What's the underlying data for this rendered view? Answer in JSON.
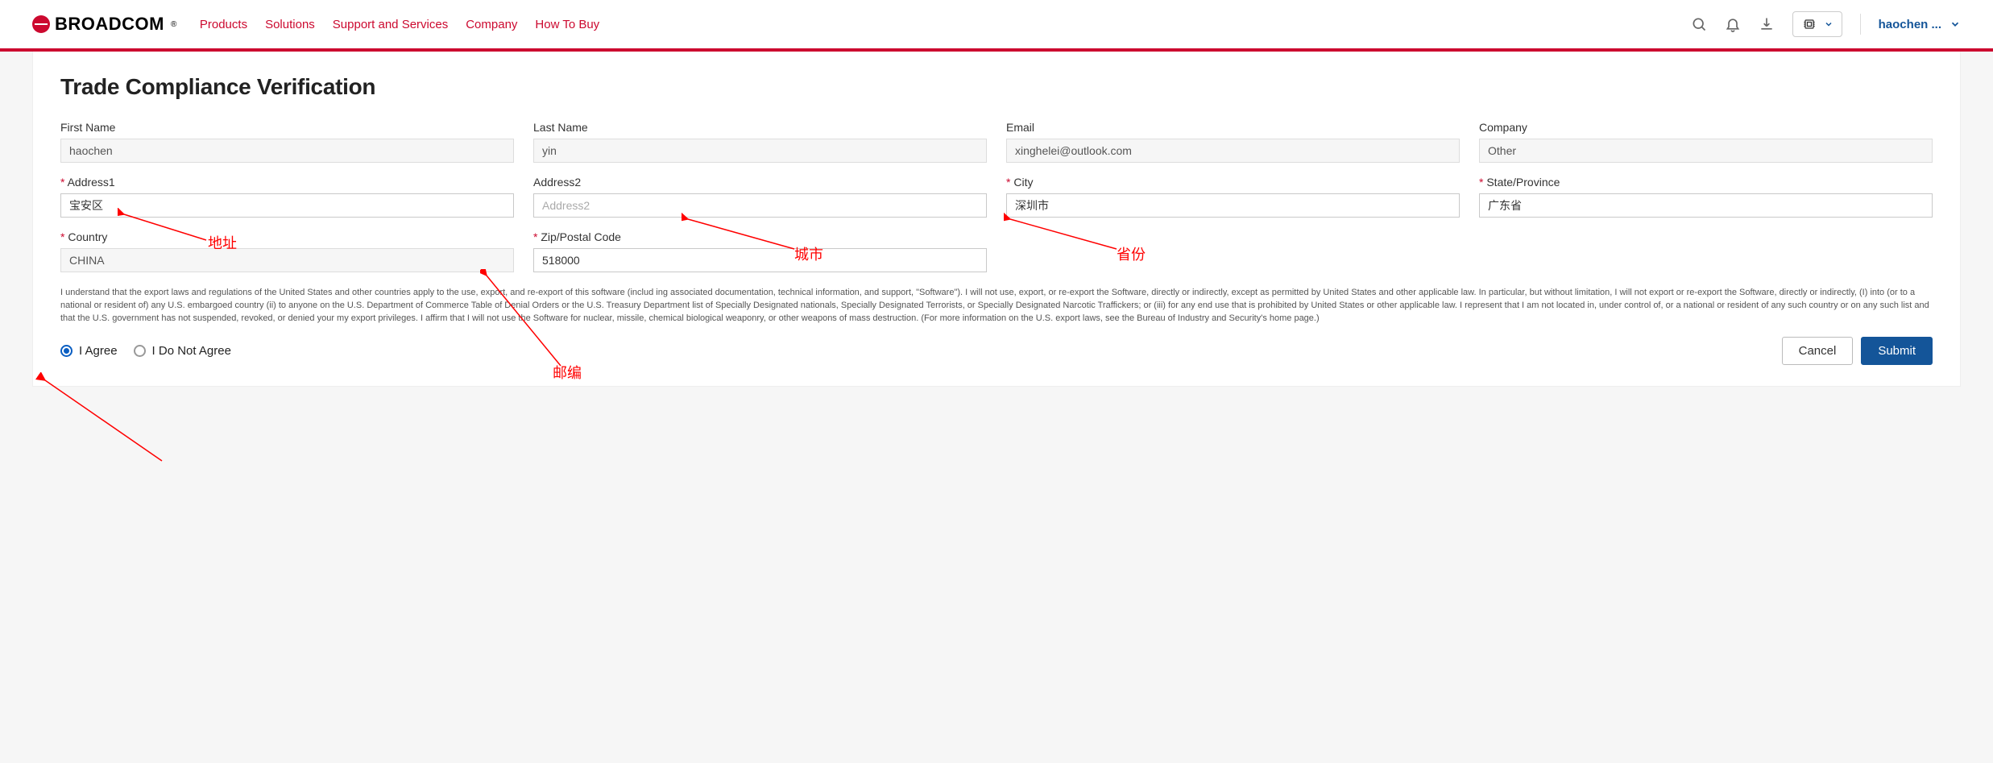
{
  "brand": {
    "name": "BROADCOM"
  },
  "nav": {
    "products": "Products",
    "solutions": "Solutions",
    "support": "Support and Services",
    "company": "Company",
    "howtobuy": "How To Buy"
  },
  "user": {
    "display": "haochen ..."
  },
  "page": {
    "title": "Trade Compliance Verification"
  },
  "fields": {
    "first_name": {
      "label": "First Name",
      "value": "haochen"
    },
    "last_name": {
      "label": "Last Name",
      "value": "yin"
    },
    "email": {
      "label": "Email",
      "value": "xinghelei@outlook.com"
    },
    "company": {
      "label": "Company",
      "value": "Other"
    },
    "address1": {
      "label": "Address1",
      "value": "宝安区"
    },
    "address2": {
      "label": "Address2",
      "placeholder": "Address2",
      "value": ""
    },
    "city": {
      "label": "City",
      "value": "深圳市"
    },
    "state": {
      "label": "State/Province",
      "value": "广东省"
    },
    "country": {
      "label": "Country",
      "value": "CHINA"
    },
    "zip": {
      "label": "Zip/Postal Code",
      "value": "518000"
    }
  },
  "disclaimer": "I understand that the export laws and regulations of the United States and other countries apply to the use, export, and re-export of this software (includ ing associated documentation, technical information, and support, \"Software\"). I will not use, export, or re-export the Software, directly or indirectly, except as permitted by United States and other applicable law. In particular, but without limitation, I will not export or re-export the Software, directly or indirectly, (I) into (or to a national or resident of) any U.S. embargoed country (ii) to anyone on the U.S. Department of Commerce Table of Denial Orders or the U.S. Treasury Department list of Specially Designated nationals, Specially Designated Terrorists, or Specially Designated Narcotic Traffickers; or (iii) for any end use that is prohibited by United States or other applicable law. I represent that I am not located in, under control of, or a national or resident of any such country or on any such list and that the U.S. government has not suspended, revoked, or denied your my export privileges. I affirm that I will not use the Software for nuclear, missile, chemical biological weaponry, or other weapons of mass destruction. (For more information on the U.S. export laws, see the Bureau of Industry and Security's home page.)",
  "consent": {
    "agree": "I Agree",
    "disagree": "I Do Not Agree",
    "selected": "agree"
  },
  "buttons": {
    "cancel": "Cancel",
    "submit": "Submit"
  },
  "annotations": {
    "address": "地址",
    "city": "城市",
    "province": "省份",
    "zip": "邮编"
  }
}
